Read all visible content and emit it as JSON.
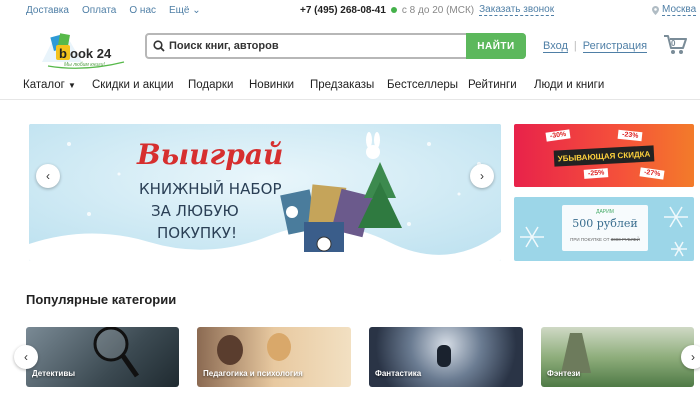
{
  "topbar": {
    "links": [
      "Доставка",
      "Оплата",
      "О нас"
    ],
    "more": "Ещё",
    "phone": "+7 (495) 268-08-41",
    "hours": "с 8 до 20 (МСК)",
    "callback": "Заказать звонок",
    "city": "Москва"
  },
  "logo": {
    "text": "book 24",
    "tagline": "Мы любим книги!"
  },
  "search": {
    "placeholder": "Поиск книг, авторов",
    "button": "НАЙТИ"
  },
  "auth": {
    "login": "Вход",
    "register": "Регистрация"
  },
  "nav": [
    "Каталог",
    "Скидки и акции",
    "Подарки",
    "Новинки",
    "Предзаказы",
    "Бестселлеры",
    "Рейтинги",
    "Люди и книги"
  ],
  "banner": {
    "line1": "Выиграй",
    "line2": "книжный набор",
    "line3": "за любую",
    "line4": "покупку!"
  },
  "side1": {
    "title": "Убывающая скидка",
    "tags": [
      "-30%",
      "-23%",
      "-25%",
      "-27%"
    ]
  },
  "side2": {
    "small": "ДАРИМ",
    "amount": "500 рублей",
    "note": "ПРИ ПОКУПКЕ ОТ",
    "strike": "3000 РУБЛЕЙ"
  },
  "popular": {
    "title": "Популярные категории",
    "cards": [
      "Детективы",
      "Педагогика и психология",
      "Фантастика",
      "Фэнтези"
    ]
  },
  "colors": {
    "accent": "#5cb85c",
    "link": "#4f7fa6"
  }
}
